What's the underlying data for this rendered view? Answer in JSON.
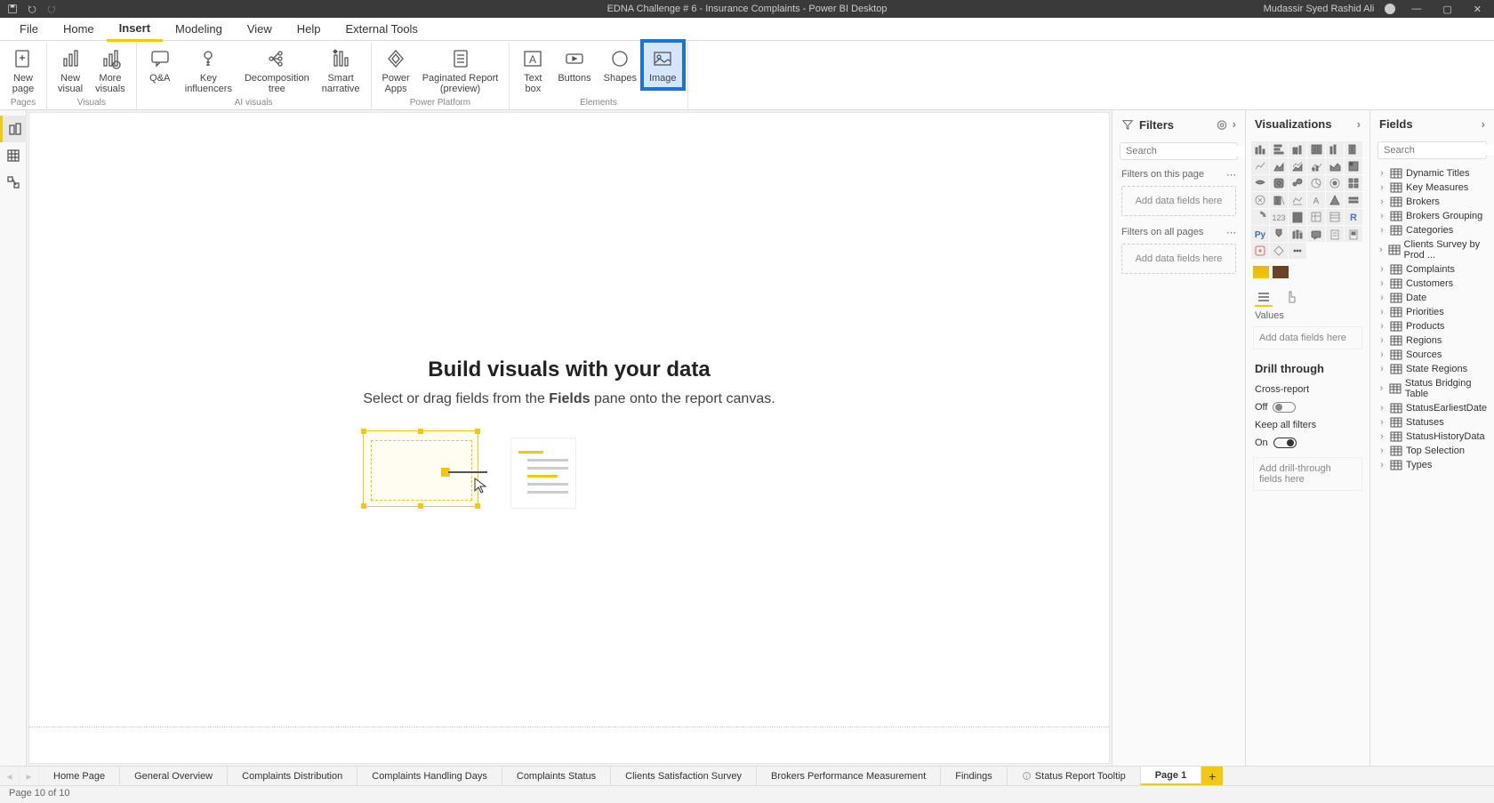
{
  "titlebar": {
    "title": "EDNA Challenge # 6 - Insurance Complaints - Power BI Desktop",
    "user": "Mudassir Syed Rashid Ali"
  },
  "menu": {
    "items": [
      "File",
      "Home",
      "Insert",
      "Modeling",
      "View",
      "Help",
      "External Tools"
    ],
    "active": "Insert"
  },
  "ribbon": {
    "groups": [
      {
        "label": "Pages",
        "items": [
          {
            "id": "newpage",
            "label": "New\npage"
          }
        ]
      },
      {
        "label": "Visuals",
        "items": [
          {
            "id": "newvisual",
            "label": "New\nvisual"
          },
          {
            "id": "morevisuals",
            "label": "More\nvisuals"
          }
        ]
      },
      {
        "label": "AI visuals",
        "items": [
          {
            "id": "qna",
            "label": "Q&A"
          },
          {
            "id": "keyinf",
            "label": "Key\ninfluencers"
          },
          {
            "id": "decomp",
            "label": "Decomposition\ntree"
          },
          {
            "id": "smartn",
            "label": "Smart\nnarrative"
          }
        ]
      },
      {
        "label": "Power Platform",
        "items": [
          {
            "id": "powerapps",
            "label": "Power\nApps"
          },
          {
            "id": "pagrep",
            "label": "Paginated Report\n(preview)"
          }
        ]
      },
      {
        "label": "Elements",
        "items": [
          {
            "id": "textbox",
            "label": "Text\nbox"
          },
          {
            "id": "buttons",
            "label": "Buttons"
          },
          {
            "id": "shapes",
            "label": "Shapes"
          },
          {
            "id": "image",
            "label": "Image",
            "highlight": true
          }
        ]
      }
    ]
  },
  "canvas": {
    "heading": "Build visuals with your data",
    "subtext_pre": "Select or drag fields from the ",
    "subtext_bold": "Fields",
    "subtext_post": " pane onto the report canvas."
  },
  "filters_pane": {
    "title": "Filters",
    "search_placeholder": "Search",
    "page_label": "Filters on this page",
    "all_label": "Filters on all pages",
    "drop_text": "Add data fields here"
  },
  "viz_pane": {
    "title": "Visualizations",
    "values_label": "Values",
    "values_drop": "Add data fields here",
    "drill_title": "Drill through",
    "cross_label": "Cross-report",
    "cross_state": "Off",
    "keep_label": "Keep all filters",
    "keep_state": "On",
    "drill_drop": "Add drill-through fields here"
  },
  "fields_pane": {
    "title": "Fields",
    "search_placeholder": "Search",
    "tables": [
      "Dynamic Titles",
      "Key Measures",
      "Brokers",
      "Brokers Grouping",
      "Categories",
      "Clients Survey by Prod ...",
      "Complaints",
      "Customers",
      "Date",
      "Priorities",
      "Products",
      "Regions",
      "Sources",
      "State Regions",
      "Status Bridging Table",
      "StatusEarliestDate",
      "Statuses",
      "StatusHistoryData",
      "Top Selection",
      "Types"
    ]
  },
  "page_tabs": {
    "tabs": [
      "Home Page",
      "General Overview",
      "Complaints Distribution",
      "Complaints Handling Days",
      "Complaints Status",
      "Clients Satisfaction Survey",
      "Brokers Performance Measurement",
      "Findings",
      "Status Report Tooltip",
      "Page 1"
    ],
    "active": "Page 1",
    "tooltip_index": 8
  },
  "status_bar": {
    "text": "Page 10 of 10"
  }
}
